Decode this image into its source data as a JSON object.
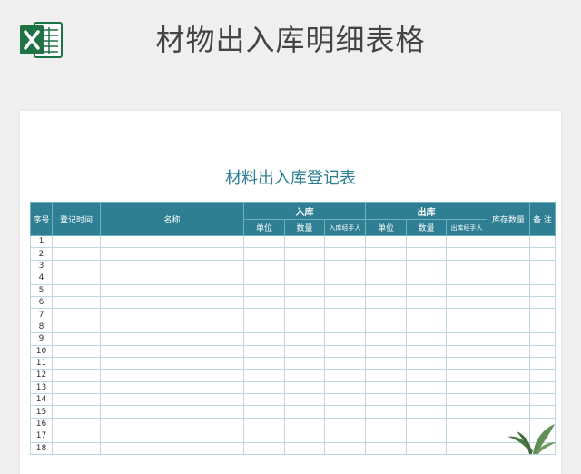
{
  "header": {
    "title": "材物出入库明细表格",
    "app_icon": "excel-icon"
  },
  "sheet": {
    "title": "材料出入库登记表",
    "columns": {
      "seq": "序号",
      "date": "登记时间",
      "name": "名称",
      "in_group": "入库",
      "out_group": "出库",
      "stock": "库存数量",
      "note": "备 注",
      "in_unit": "单位",
      "in_qty": "数量",
      "in_handler": "入库经手人",
      "out_unit": "单位",
      "out_qty": "数量",
      "out_handler": "出库经手人"
    },
    "rows": [
      "1",
      "2",
      "3",
      "4",
      "5",
      "6",
      "7",
      "8",
      "9",
      "10",
      "11",
      "12",
      "13",
      "14",
      "15",
      "16",
      "17",
      "18"
    ]
  },
  "colors": {
    "header_teal": "#2e7f93",
    "title_teal": "#2d7f93",
    "excel_green": "#1f7244"
  }
}
